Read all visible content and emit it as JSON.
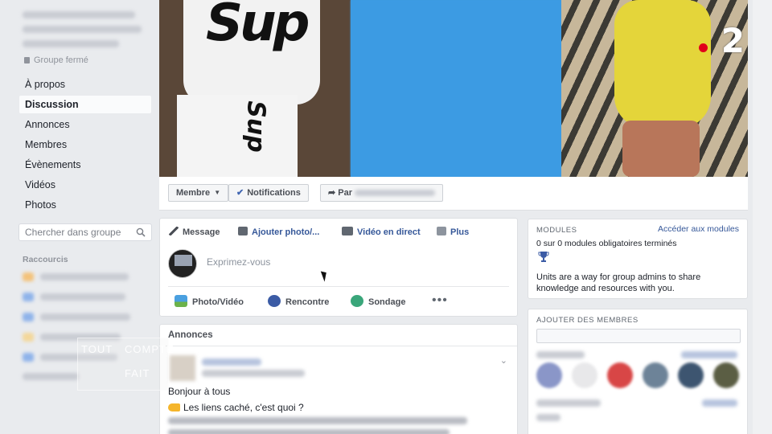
{
  "sidebar": {
    "group_privacy": "Groupe fermé",
    "nav": [
      {
        "label": "À propos",
        "active": false
      },
      {
        "label": "Discussion",
        "active": true
      },
      {
        "label": "Annonces",
        "active": false
      },
      {
        "label": "Membres",
        "active": false
      },
      {
        "label": "Évènements",
        "active": false
      },
      {
        "label": "Vidéos",
        "active": false
      },
      {
        "label": "Photos",
        "active": false
      }
    ],
    "search_placeholder": "Chercher dans groupe",
    "shortcuts_title": "Raccourcis"
  },
  "cover": {
    "shirt_text": "Sup",
    "channel": "2"
  },
  "cover_bar": {
    "member_label": "Membre",
    "notifications_label": "Notifications",
    "share_label": "Par"
  },
  "composer": {
    "tabs": {
      "message": "Message",
      "add_photo": "Ajouter photo/...",
      "live": "Vidéo en direct",
      "more": "Plus"
    },
    "placeholder": "Exprimez-vous",
    "actions": {
      "photo_video": "Photo/Vidéo",
      "meetup": "Rencontre",
      "poll": "Sondage"
    }
  },
  "announcements": {
    "title": "Annonces",
    "line1": "Bonjour à tous",
    "line2": "Les liens caché, c'est quoi ?"
  },
  "modules": {
    "title": "MODULES",
    "link": "Accéder aux modules",
    "status": "0 sur 0 modules obligatoires terminés",
    "description": "Units are a way for group admins to share knowledge and resources with you."
  },
  "add_members": {
    "title": "AJOUTER DES MEMBRES"
  },
  "watermark": {
    "line1": "TOUT",
    "line2": "COMPTE",
    "line3": "FAIT"
  },
  "colors": {
    "link": "#365899",
    "cover_blue": "#3c9be3",
    "dress_yellow": "#e4d53a",
    "channel_red": "#e1001a"
  }
}
